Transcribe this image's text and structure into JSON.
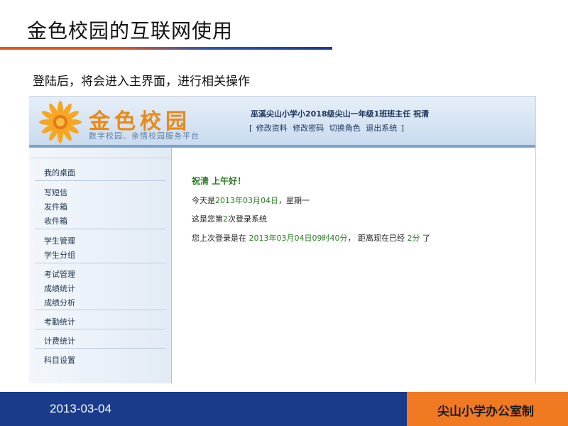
{
  "slide": {
    "title": "金色校园的互联网使用",
    "subtitle": "登陆后，将会进入主界面，进行相关操作"
  },
  "app": {
    "logo_text": "金色校园",
    "logo_subtitle": "数字校园、亲情校园服务平台",
    "user_line": "巫溪尖山小学小2018级尖山一年级1班班主任  祝清",
    "menu_open": "[",
    "menu_close": "]",
    "menu": [
      "修改资料",
      "修改密码",
      "切换角色",
      "退出系统"
    ]
  },
  "sidebar": {
    "items": [
      "我的桌面",
      "写短信",
      "发件箱",
      "收件箱",
      "学生管理",
      "学生分组",
      "考试管理",
      "成绩统计",
      "成绩分析",
      "考勤统计",
      "计费统计",
      "科目设置"
    ]
  },
  "main": {
    "greeting": "祝清 上午好！",
    "today_prefix": "今天是",
    "today_date": "2013年03月04日",
    "today_sep": "，",
    "weekday": "星期一",
    "login_prefix": "这是您第",
    "login_count": "2",
    "login_suffix": "次登录系统",
    "last_prefix": "您上次登录是在",
    "last_time": "2013年03月04日09时40分",
    "last_mid": "， 距离现在已经",
    "last_ago": "2分",
    "last_suffix": "了"
  },
  "footer": {
    "date": "2013-03-04",
    "credit": "尖山小学办公室制"
  },
  "colors": {
    "accent_orange": "#f07a22",
    "footer_blue": "#1a3a8c",
    "highlight_green": "#2a7a24"
  }
}
